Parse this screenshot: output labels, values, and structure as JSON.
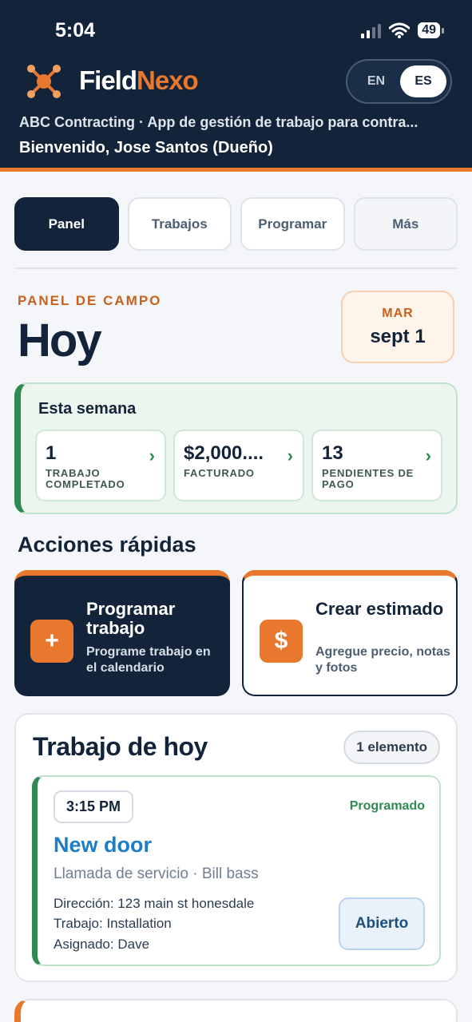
{
  "status_bar": {
    "time": "5:04",
    "battery": "49"
  },
  "brand": {
    "part1": "Field",
    "part2": "Nexo"
  },
  "language": {
    "en": "EN",
    "es": "ES",
    "selected": "ES"
  },
  "header": {
    "company_line": "ABC Contracting · App de gestión de trabajo para contra...",
    "welcome": "Bienvenido, Jose Santos (Dueño)"
  },
  "tabs": [
    {
      "label": "Panel",
      "active": true
    },
    {
      "label": "Trabajos",
      "active": false
    },
    {
      "label": "Programar",
      "active": false
    },
    {
      "label": "Más",
      "active": false
    }
  ],
  "dashboard": {
    "eyebrow": "PANEL DE CAMPO",
    "title": "Hoy",
    "date_dow": "MAR",
    "date_day": "sept 1"
  },
  "week": {
    "title": "Esta semana",
    "stats": [
      {
        "value": "1",
        "label": "TRABAJO COMPLETADO"
      },
      {
        "value": "$2,000....",
        "label": "FACTURADO"
      },
      {
        "value": "13",
        "label": "PENDIENTES DE PAGO"
      }
    ]
  },
  "quick_actions": {
    "title": "Acciones rápidas",
    "items": [
      {
        "title": "Programar trabajo",
        "subtitle": "Programe trabajo en el calendario",
        "icon": "plus-icon",
        "icon_glyph": "+"
      },
      {
        "title": "Crear estimado",
        "subtitle": "Agregue precio, notas y fotos",
        "icon": "dollar-icon",
        "icon_glyph": "$"
      }
    ]
  },
  "todays_work": {
    "title": "Trabajo de hoy",
    "count": "1 elemento",
    "job": {
      "time": "3:15 PM",
      "status": "Programado",
      "name": "New door",
      "type": "Llamada de servicio · Bill bass",
      "address": "Dirección: 123 main st honesdale",
      "work": "Trabajo: Installation",
      "assigned": "Asignado: Dave",
      "open_label": "Abierto"
    }
  },
  "colors": {
    "navy": "#13243a",
    "accent_orange": "#e8782e",
    "success_green": "#2f8a52",
    "link_blue": "#1d7ec7"
  }
}
